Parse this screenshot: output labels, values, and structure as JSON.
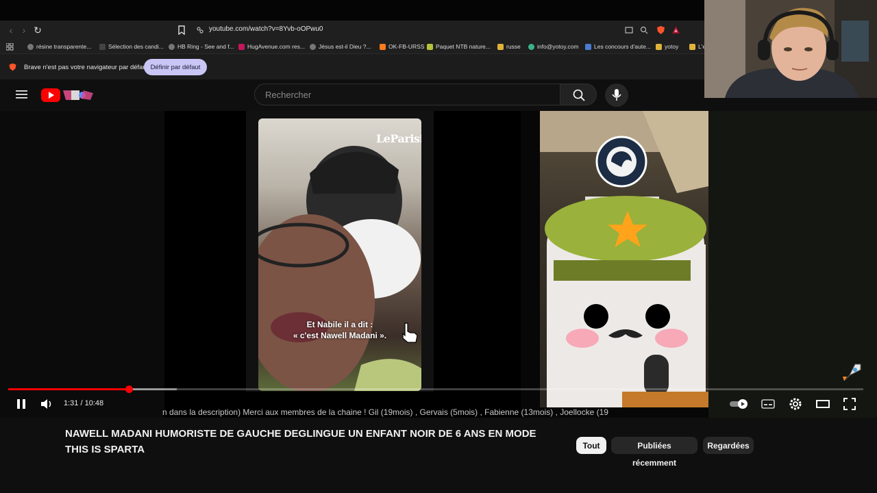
{
  "browser": {
    "url": "youtube.com/watch?v=8Yvb-oOPwu0",
    "bookmarks": [
      "résine transparente...",
      "Sélection des candi...",
      "HB Ring - See and f...",
      "HugAvenue.com res...",
      "Jésus est-il Dieu ?...",
      "OK-FB-URSS",
      "Paquet NTB nature...",
      "russe",
      "info@yotoy.com",
      "Les concours d'aute...",
      "yotoy",
      "L'es"
    ],
    "infobar_text": "Brave n'est pas votre navigateur par défaut",
    "infobar_button": "Définir par défaut"
  },
  "youtube": {
    "search_placeholder": "Rechercher"
  },
  "video": {
    "overlay_brand": "LeParisien",
    "caption_line1": "Et Nabile il a dit :",
    "caption_line2": "« c'est Nawell Madani ».",
    "time": "1:31 / 10:48",
    "progress_fraction": 0.145,
    "ticker": "n dans la description)          Merci aux membres de la chaine ! Gil (19mois) , Gervais (5mois) , Fabienne (13mois) , Joellocke (19"
  },
  "page": {
    "title": "NAWELL MADANI HUMORISTE DE GAUCHE DEGLINGUE UN ENFANT NOIR DE 6 ANS EN MODE THIS IS SPARTA",
    "chips": [
      "Tout",
      "Publiées récemment",
      "Regardées"
    ]
  },
  "icons": {
    "accent_red": "#ff0000",
    "brave_orange": "#fb542b"
  }
}
